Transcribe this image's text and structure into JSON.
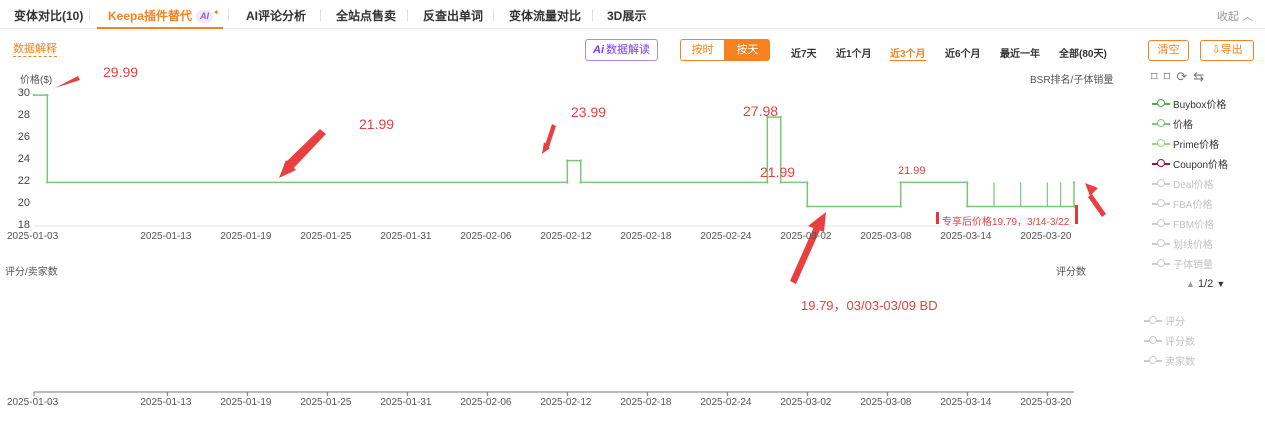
{
  "tabs": [
    {
      "label": "变体对比(10)",
      "active": false
    },
    {
      "label": "Keepa插件替代",
      "active": true,
      "badge": "AI"
    },
    {
      "label": "AI评论分析",
      "active": false
    },
    {
      "label": "全站点售卖",
      "active": false
    },
    {
      "label": "反查出单词",
      "active": false
    },
    {
      "label": "变体流量对比",
      "active": false
    },
    {
      "label": "3D展示",
      "active": false
    }
  ],
  "collapse_label": "收起 ︿",
  "data_explain": "数据解释",
  "ai_read": {
    "icon": "Ai",
    "label": "数据解读"
  },
  "granularity": {
    "hour": "按时",
    "day": "按天"
  },
  "ranges": [
    {
      "label": "近7天",
      "active": false
    },
    {
      "label": "近1个月",
      "active": false
    },
    {
      "label": "近3个月",
      "active": true
    },
    {
      "label": "近6个月",
      "active": false
    },
    {
      "label": "最近一年",
      "active": false
    },
    {
      "label": "全部(80天)",
      "active": false
    }
  ],
  "clear_label": "清空",
  "export_label": "⇩导出",
  "upper_chart": {
    "ylabel": "价格($)",
    "right_label": "BSR排名/子体销量"
  },
  "lower_chart": {
    "left_label": "评分/卖家数",
    "right_label": "评分数"
  },
  "chart_data": [
    {
      "type": "line",
      "ylabel": "价格($)",
      "ylim": [
        18,
        30
      ],
      "yticks": [
        18,
        20,
        22,
        24,
        26,
        28,
        30
      ],
      "xticks": [
        "2025-01-03",
        "2025-01-13",
        "2025-01-19",
        "2025-01-25",
        "2025-01-31",
        "2025-02-06",
        "2025-02-12",
        "2025-02-18",
        "2025-02-24",
        "2025-03-02",
        "2025-03-08",
        "2025-03-14",
        "2025-03-20"
      ],
      "series": [
        {
          "name": "价格",
          "color": "#7cc67c",
          "points": [
            [
              "2025-01-03",
              29.99
            ],
            [
              "2025-01-04",
              29.99
            ],
            [
              "2025-01-04",
              21.99
            ],
            [
              "2025-02-12",
              21.99
            ],
            [
              "2025-02-12",
              23.99
            ],
            [
              "2025-02-13",
              23.99
            ],
            [
              "2025-02-13",
              21.99
            ],
            [
              "2025-02-27",
              21.99
            ],
            [
              "2025-02-27",
              27.98
            ],
            [
              "2025-02-28",
              27.98
            ],
            [
              "2025-02-28",
              21.99
            ],
            [
              "2025-03-02",
              21.99
            ],
            [
              "2025-03-02",
              19.79
            ],
            [
              "2025-03-09",
              19.79
            ],
            [
              "2025-03-09",
              21.99
            ],
            [
              "2025-03-14",
              21.99
            ],
            [
              "2025-03-14",
              19.79
            ],
            [
              "2025-03-22",
              19.79
            ],
            [
              "2025-03-22",
              21.99
            ]
          ]
        }
      ]
    },
    {
      "type": "line",
      "left_label": "评分/卖家数",
      "right_label": "评分数",
      "xticks": [
        "2025-01-03",
        "2025-01-13",
        "2025-01-19",
        "2025-01-25",
        "2025-01-31",
        "2025-02-06",
        "2025-02-12",
        "2025-02-18",
        "2025-02-24",
        "2025-03-02",
        "2025-03-08",
        "2025-03-14",
        "2025-03-20"
      ],
      "series": []
    }
  ],
  "annotations": {
    "p1": "29.99",
    "p2": "21.99",
    "p3": "23.99",
    "p4": "27.98",
    "p5": "21.99",
    "p6": "21.99",
    "bd_note": "19.79，03/03-03/09  BD",
    "exclusive_note": "专享后价格19.79，3/14-3/22"
  },
  "legend": [
    {
      "label": "Buybox价格",
      "color": "#4caf50",
      "on": true
    },
    {
      "label": "价格",
      "color": "#7cc67c",
      "on": true
    },
    {
      "label": "Prime价格",
      "color": "#9ed67a",
      "on": true
    },
    {
      "label": "Coupon价格",
      "color": "#a0123c",
      "on": true
    },
    {
      "label": "Deal价格",
      "color": "#cccccc",
      "on": false
    },
    {
      "label": "FBA价格",
      "color": "#cccccc",
      "on": false
    },
    {
      "label": "FBM价格",
      "color": "#cccccc",
      "on": false
    },
    {
      "label": "划线价格",
      "color": "#cccccc",
      "on": false
    },
    {
      "label": "子体销量",
      "color": "#cccccc",
      "on": false
    }
  ],
  "pager": {
    "up": "▲",
    "text": "1/2",
    "down": "▼"
  },
  "legend2": [
    {
      "label": "评分",
      "on": false
    },
    {
      "label": "评分数",
      "on": false
    },
    {
      "label": "卖家数",
      "on": false
    }
  ],
  "toolbar_icons": [
    "crop-icon",
    "crop-alt-icon",
    "refresh-icon",
    "swap-icon"
  ],
  "colors": {
    "accent": "#f5821f",
    "line": "#7cc67c",
    "annotation": "#e84040",
    "marker": "#e53935"
  }
}
